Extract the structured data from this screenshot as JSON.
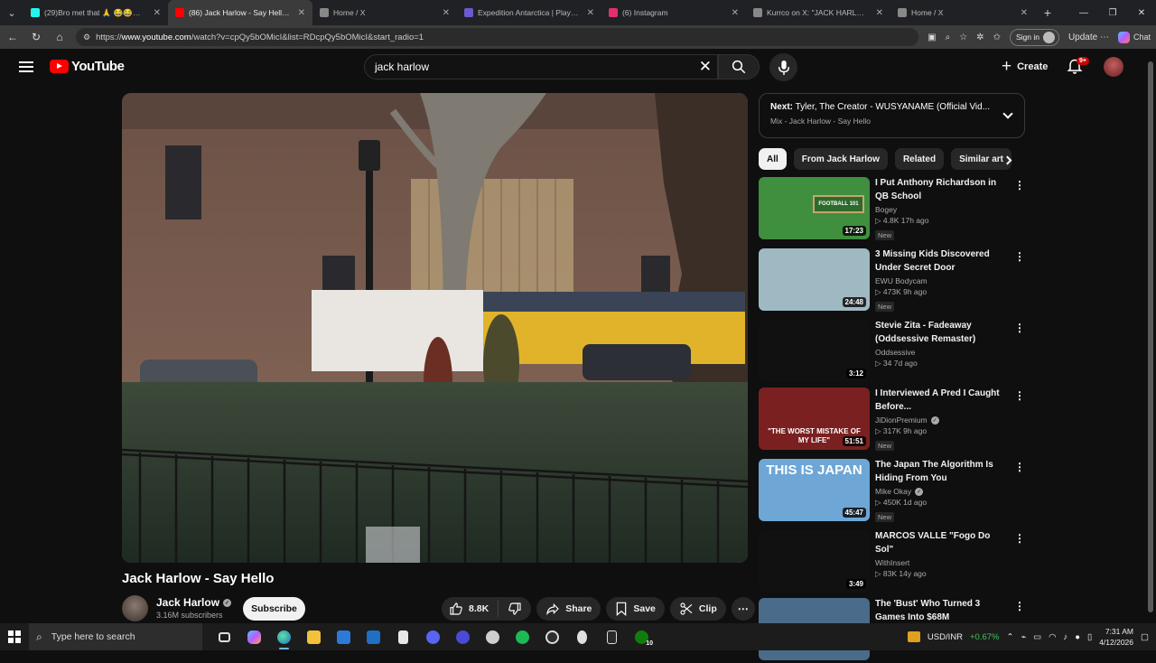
{
  "browser": {
    "tabs": [
      {
        "label": "(29)Bro met that 🙏 😂😂😂 #fy",
        "color": "#25f4ee",
        "icon": "tiktok-icon"
      },
      {
        "label": "(86) Jack Harlow - Say Hello - You",
        "color": "#ff0000",
        "icon": "youtube-icon",
        "active": true
      },
      {
        "label": "Home / X",
        "color": "#888888",
        "icon": "x-icon"
      },
      {
        "label": "Expedition Antarctica | Play on",
        "color": "#6a5acd",
        "icon": "game-icon"
      },
      {
        "label": "(6) Instagram",
        "color": "#e1306c",
        "icon": "instagram-icon"
      },
      {
        "label": "Kurrco on X: \"JACK HARLOW SAY",
        "color": "#888888",
        "icon": "x-icon"
      },
      {
        "label": "Home / X",
        "color": "#888888",
        "icon": "x-icon"
      }
    ],
    "url_prefix": "https://",
    "url_host": "www.youtube.com",
    "url_path": "/watch?v=cpQy5bOMicI&list=RDcpQy5bOMicI&start_radio=1",
    "signin_label": "Sign in",
    "update_label": "Update",
    "chat_label": "Chat"
  },
  "youtube": {
    "logo_text": "YouTube",
    "search_value": "jack harlow",
    "create_label": "Create",
    "notif_badge": "9+"
  },
  "video": {
    "title": "Jack Harlow - Say Hello",
    "channel": "Jack Harlow",
    "subscribers": "3.16M subscribers",
    "subscribe_label": "Subscribe",
    "likes": "8.8K",
    "share_label": "Share",
    "save_label": "Save",
    "clip_label": "Clip"
  },
  "next_up": {
    "prefix": "Next:",
    "title": "Tyler, The Creator - WUSYANAME (Official Vid...",
    "subtitle": "Mix - Jack Harlow - Say Hello"
  },
  "chips": [
    "All",
    "From Jack Harlow",
    "Related",
    "Similar art"
  ],
  "recommendations": [
    {
      "title": "I Put Anthony Richardson in QB School",
      "channel": "Bogey",
      "verified": false,
      "meta": "▷ 4.8K   17h ago",
      "new": "New",
      "duration": "17:23",
      "thumb_bg": "#3f8f3f",
      "thumb_text": "FOOTBALL 101"
    },
    {
      "title": "3 Missing Kids Discovered Under Secret Door",
      "channel": "EWU Bodycam",
      "verified": false,
      "meta": "▷ 473K   9h ago",
      "new": "New",
      "duration": "24:48",
      "thumb_bg": "#9fb9c2",
      "thumb_text": ""
    },
    {
      "title": "Stevie Zita - Fadeaway (Oddsessive Remaster)",
      "channel": "Oddsessive",
      "verified": false,
      "meta": "▷ 34   7d ago",
      "new": "",
      "duration": "3:12",
      "thumb_bg": "#111111",
      "thumb_text": ""
    },
    {
      "title": "I Interviewed A Pred I Caught Before...",
      "channel": "JiDionPremium",
      "verified": true,
      "meta": "▷ 317K   9h ago",
      "new": "New",
      "duration": "51:51",
      "thumb_bg": "#7a2020",
      "thumb_text": "\"THE WORST MISTAKE OF MY LIFE\""
    },
    {
      "title": "The Japan The Algorithm Is Hiding From You",
      "channel": "Mike Okay",
      "verified": true,
      "meta": "▷ 450K   1d ago",
      "new": "New",
      "duration": "45:47",
      "thumb_bg": "#6ea6d6",
      "thumb_text": "THIS IS JAPAN"
    },
    {
      "title": "MARCOS VALLE \"Fogo Do Sol\"",
      "channel": "WithInsert",
      "verified": false,
      "meta": "▷ 83K   14y ago",
      "new": "",
      "duration": "3:49",
      "thumb_bg": "#111111",
      "thumb_text": ""
    },
    {
      "title": "The 'Bust' Who Turned 3 Games Into $68M",
      "channel": "",
      "verified": false,
      "meta": "",
      "new": "",
      "duration": "",
      "thumb_bg": "#4a6b8a",
      "thumb_text": ""
    }
  ],
  "taskbar": {
    "search_placeholder": "Type here to search",
    "ticker": "USD/INR",
    "ticker_change": "+0.67%",
    "time": "7:31 AM",
    "date": "4/12/2026",
    "xbox_badge": "10"
  }
}
